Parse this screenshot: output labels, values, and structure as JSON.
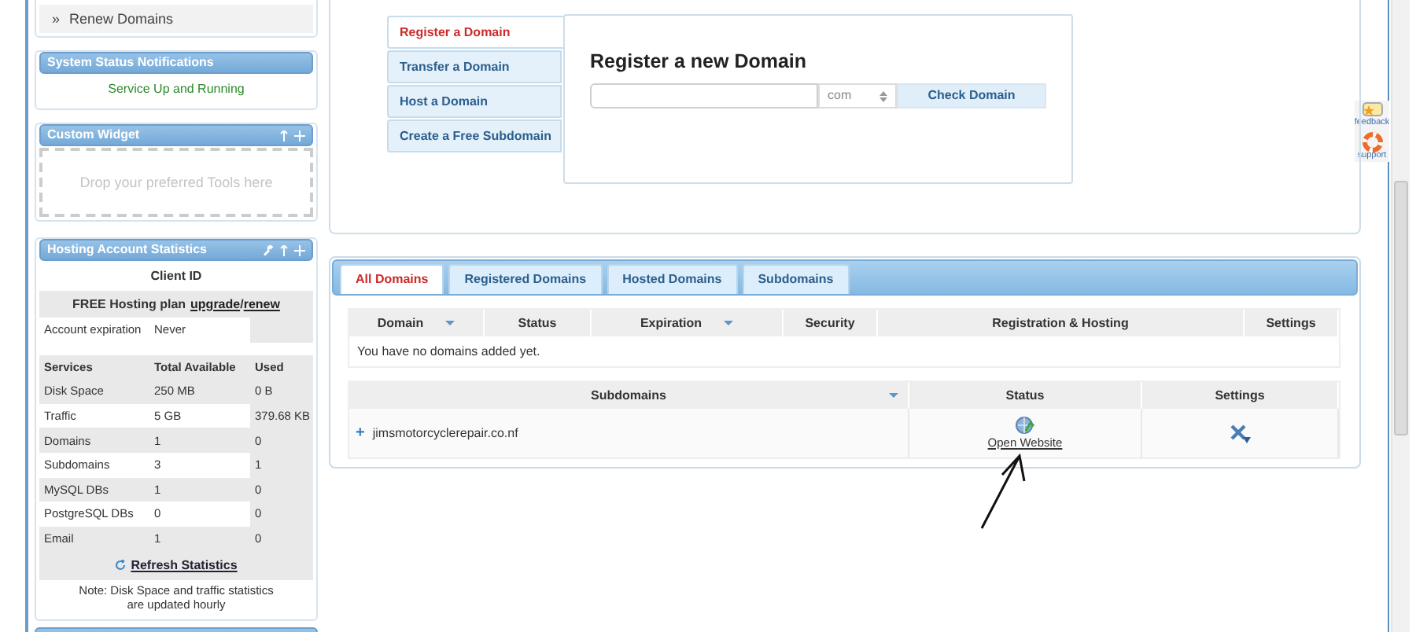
{
  "sidebar": {
    "menu_items": [
      {
        "bullet": "»",
        "label": "Renew Domains"
      }
    ],
    "status_widget": {
      "title": "System Status Notifications",
      "message": "Service Up and Running",
      "configurable": false,
      "movable": false
    },
    "custom_widget": {
      "title": "Custom Widget",
      "hint": "Drop your preferred Tools here",
      "configurable": false,
      "movable": true
    },
    "stats_widget": {
      "title": "Hosting Account Statistics",
      "configurable": true,
      "movable": true,
      "client_id": "Client ID",
      "plan": {
        "text": "FREE Hosting plan",
        "links": [
          "upgrade",
          "renew"
        ],
        "separator": "/"
      },
      "account": {
        "label": "Account expiration",
        "value": "Never"
      },
      "columns": [
        "Services",
        "Total Available",
        "Used"
      ],
      "rows": [
        [
          "Disk Space",
          "250 MB",
          "0 B"
        ],
        [
          "Traffic",
          "5 GB",
          "379.68 KB"
        ],
        [
          "Domains",
          "1",
          "0"
        ],
        [
          "Subdomains",
          "3",
          "1"
        ],
        [
          "MySQL DBs",
          "1",
          "0"
        ],
        [
          "PostgreSQL DBs",
          "0",
          "0"
        ],
        [
          "Email",
          "1",
          "0"
        ]
      ],
      "refresh": "Refresh Statistics",
      "note": [
        "Note: Disk Space and traffic statistics",
        "are updated hourly"
      ]
    }
  },
  "domain_actions": {
    "tabs": [
      {
        "label": "Register a Domain",
        "selected": true
      },
      {
        "label": "Transfer a Domain",
        "selected": false
      },
      {
        "label": "Host a Domain",
        "selected": false
      },
      {
        "label": "Create a Free Subdomain",
        "selected": false
      }
    ],
    "title": "Register a new Domain",
    "tld": "com",
    "button": "Check Domain"
  },
  "domains_panel": {
    "tabs": [
      {
        "label": "All Domains",
        "selected": true
      },
      {
        "label": "Registered Domains",
        "selected": false
      },
      {
        "label": "Hosted Domains",
        "selected": false
      },
      {
        "label": "Subdomains",
        "selected": false
      }
    ],
    "domains_table": {
      "columns": [
        {
          "label": "Domain",
          "sortable": true
        },
        {
          "label": "Status",
          "sortable": false
        },
        {
          "label": "Expiration",
          "sortable": true
        },
        {
          "label": "Security",
          "sortable": false
        },
        {
          "label": "Registration & Hosting",
          "sortable": false
        },
        {
          "label": "Settings",
          "sortable": false
        }
      ],
      "empty_message": "You have no domains added yet."
    },
    "subdomains_table": {
      "columns": [
        {
          "label": "Subdomains",
          "sortable": true
        },
        {
          "label": "Status",
          "sortable": false
        },
        {
          "label": "Settings",
          "sortable": false
        }
      ],
      "rows": [
        {
          "expander": "+",
          "name": "jimsmotorcyclerepair.co.nf",
          "status_link": "Open Website"
        }
      ]
    }
  },
  "side_widgets": [
    {
      "kind": "feedback",
      "label": "feedback"
    },
    {
      "kind": "support",
      "label": "support"
    }
  ]
}
